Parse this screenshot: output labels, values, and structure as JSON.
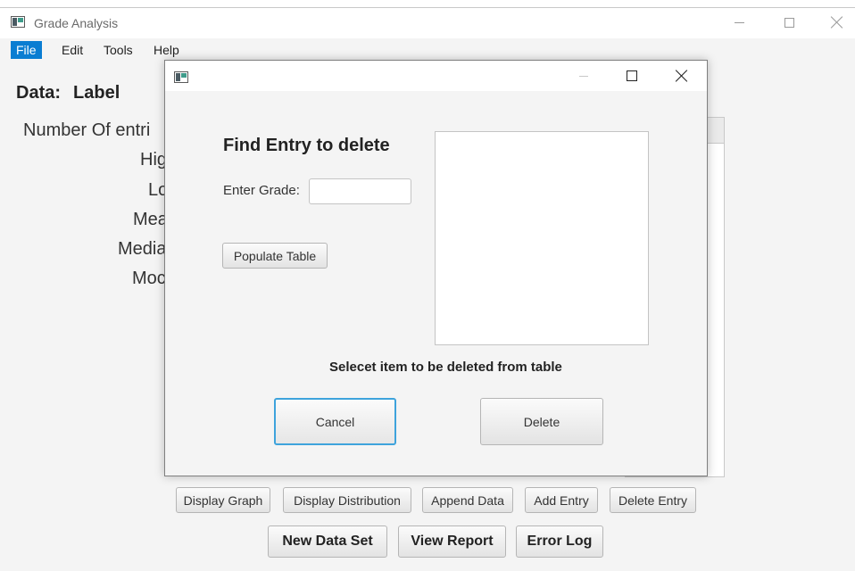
{
  "window": {
    "title": "Grade Analysis",
    "controls": {
      "minimize": "—",
      "maximize": "□",
      "close": "✕"
    }
  },
  "menu": [
    {
      "label": "File",
      "active": true
    },
    {
      "label": "Edit",
      "active": false
    },
    {
      "label": "Tools",
      "active": false
    },
    {
      "label": "Help",
      "active": false
    }
  ],
  "data_header": {
    "prefix": "Data:",
    "label": "Label"
  },
  "stats": {
    "entries": "Number Of entri",
    "high": "Hig",
    "low": "Lo",
    "mean": "Mea",
    "median": "Media",
    "mode": "Moc"
  },
  "bottom_buttons": {
    "display_graph": "Display Graph",
    "display_distribution": "Display Distribution",
    "append_data": "Append Data",
    "add_entry": "Add Entry",
    "delete_entry": "Delete Entry",
    "new_data_set": "New Data Set",
    "view_report": "View Report",
    "error_log": "Error Log"
  },
  "dialog": {
    "heading": "Find Entry to delete",
    "grade_label": "Enter Grade:",
    "grade_value": "",
    "populate_button": "Populate Table",
    "instruction": "Selecet item to be deleted from table",
    "cancel_button": "Cancel",
    "delete_button": "Delete"
  },
  "colors": {
    "menu_active": "#0a7dd2",
    "focus_border": "#3ea3dc",
    "window_bg": "#f4f4f4"
  }
}
